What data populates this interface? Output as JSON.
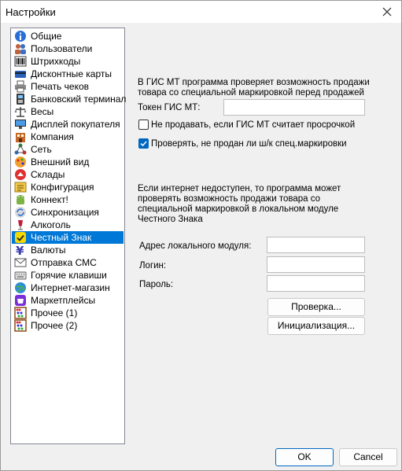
{
  "window": {
    "title": "Настройки"
  },
  "sidebar": {
    "selected_index": 16,
    "items": [
      {
        "label": "Общие",
        "icon": "info-icon"
      },
      {
        "label": "Пользователи",
        "icon": "users-icon"
      },
      {
        "label": "Штрихкоды",
        "icon": "barcode-icon"
      },
      {
        "label": "Дисконтные карты",
        "icon": "card-icon"
      },
      {
        "label": "Печать чеков",
        "icon": "printer-icon"
      },
      {
        "label": "Банковский терминал",
        "icon": "terminal-icon"
      },
      {
        "label": "Весы",
        "icon": "scales-icon"
      },
      {
        "label": "Дисплей покупателя",
        "icon": "display-icon"
      },
      {
        "label": "Компания",
        "icon": "company-icon"
      },
      {
        "label": "Сеть",
        "icon": "network-icon"
      },
      {
        "label": "Внешний вид",
        "icon": "appearance-icon"
      },
      {
        "label": "Склады",
        "icon": "warehouse-icon"
      },
      {
        "label": "Конфигурация",
        "icon": "configuration-icon"
      },
      {
        "label": "Коннект!",
        "icon": "android-icon"
      },
      {
        "label": "Синхронизация",
        "icon": "sync-icon"
      },
      {
        "label": "Алкоголь",
        "icon": "alcohol-icon"
      },
      {
        "label": "Честный Знак",
        "icon": "honest-sign-icon"
      },
      {
        "label": "Валюты",
        "icon": "currency-icon"
      },
      {
        "label": "Отправка СМС",
        "icon": "sms-icon"
      },
      {
        "label": "Горячие клавиши",
        "icon": "keyboard-icon"
      },
      {
        "label": "Интернет-магазин",
        "icon": "globe-icon"
      },
      {
        "label": "Маркетплейсы",
        "icon": "marketplace-icon"
      },
      {
        "label": "Прочее (1)",
        "icon": "abacus-icon"
      },
      {
        "label": "Прочее (2)",
        "icon": "abacus-icon"
      }
    ]
  },
  "panel": {
    "intro": [
      "В ГИС МТ программа проверяет возможность продажи",
      "товара со специальной маркировкой перед продажей"
    ],
    "token_label": "Токен ГИС МТ:",
    "token_value": "",
    "cb_expired_label": "Не продавать, если ГИС МТ считает просрочкой",
    "cb_expired_checked": false,
    "cb_sold_label": "Проверять, не продан ли ш/к спец.маркировки",
    "cb_sold_checked": true,
    "offline_text": [
      "Если интернет недоступен, то программа может",
      "проверять возможность продажи товара со",
      "специальной маркировкой в локальном модуле",
      "Честного Знака"
    ],
    "module_address_label": "Адрес локального модуля:",
    "module_address_value": "",
    "login_label": "Логин:",
    "login_value": "",
    "password_label": "Пароль:",
    "password_value": "",
    "check_button": "Проверка...",
    "init_button": "Инициализация..."
  },
  "footer": {
    "ok_label": "OK",
    "cancel_label": "Cancel"
  },
  "colors": {
    "selection": "#0078d7",
    "accent": "#0067c0"
  }
}
